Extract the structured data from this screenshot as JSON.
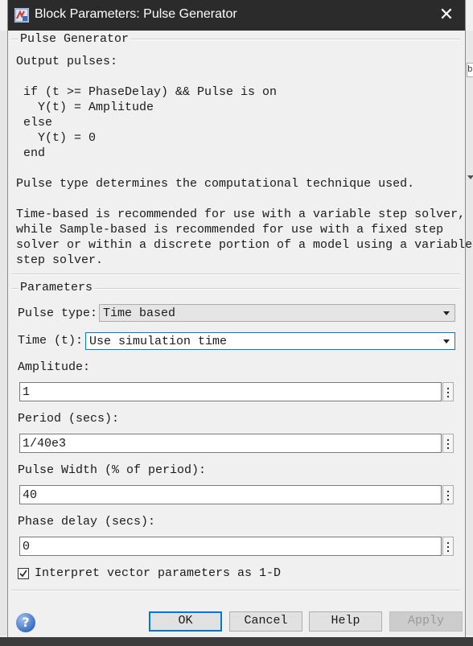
{
  "window": {
    "title": "Block Parameters: Pulse Generator",
    "close_glyph": "✕"
  },
  "description": {
    "group_title": "Pulse Generator",
    "lines": [
      "Output pulses:",
      "",
      " if (t >= PhaseDelay) && Pulse is on",
      "   Y(t) = Amplitude",
      " else",
      "   Y(t) = 0",
      " end",
      "",
      "Pulse type determines the computational technique used.",
      "",
      "Time-based is recommended for use with a variable step solver,",
      "while Sample-based is recommended for use with a fixed step",
      "solver or within a discrete portion of a model using a variable",
      "step solver."
    ]
  },
  "parameters": {
    "group_title": "Parameters",
    "pulse_type": {
      "label": "Pulse type:",
      "value": "Time based"
    },
    "time": {
      "label": "Time (t):",
      "value": "Use simulation time"
    },
    "amplitude": {
      "label": "Amplitude:",
      "value": "1"
    },
    "period": {
      "label": "Period (secs):",
      "value": "1/40e3"
    },
    "pulse_width": {
      "label": "Pulse Width (% of period):",
      "value": "40"
    },
    "phase_delay": {
      "label": "Phase delay (secs):",
      "value": "0"
    },
    "interpret_vector": {
      "label": "Interpret vector parameters as 1-D",
      "checked": true
    }
  },
  "buttons": {
    "ok": "OK",
    "cancel": "Cancel",
    "help": "Help",
    "apply": "Apply",
    "help_icon": "?"
  },
  "background": {
    "right_fragment": "b"
  },
  "icons": {
    "app": "simulink-block-icon",
    "help": "help-circle-icon",
    "close": "close-icon",
    "dots": "more-options-icon"
  },
  "colors": {
    "titlebar": "#2b2b2b",
    "focus_border": "#0078d7",
    "dialog_bg": "#f0f0f0"
  }
}
